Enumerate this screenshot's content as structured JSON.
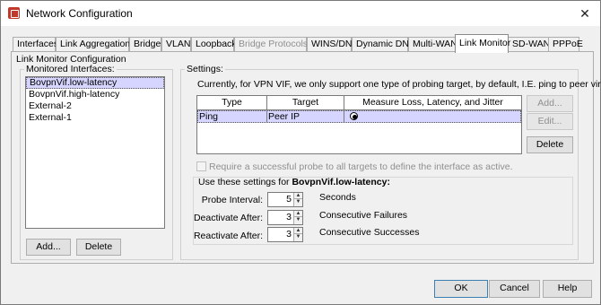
{
  "window": {
    "title": "Network Configuration",
    "close_glyph": "✕"
  },
  "tabs": [
    {
      "label": "Interfaces",
      "state": "normal"
    },
    {
      "label": "Link Aggregation",
      "state": "normal"
    },
    {
      "label": "Bridge",
      "state": "normal"
    },
    {
      "label": "VLAN",
      "state": "normal"
    },
    {
      "label": "Loopback",
      "state": "normal"
    },
    {
      "label": "Bridge Protocols",
      "state": "disabled"
    },
    {
      "label": "WINS/DNS",
      "state": "normal"
    },
    {
      "label": "Dynamic DNS",
      "state": "normal"
    },
    {
      "label": "Multi-WAN",
      "state": "normal"
    },
    {
      "label": "Link Monitor",
      "state": "active"
    },
    {
      "label": "SD-WAN",
      "state": "normal"
    },
    {
      "label": "PPPoE",
      "state": "normal"
    }
  ],
  "panel": {
    "heading": "Link Monitor Configuration",
    "monitored_title": "Monitored Interfaces:",
    "interfaces": [
      "BovpnVif.low-latency",
      "BovpnVif.high-latency",
      "External-2",
      "External-1"
    ],
    "add_label": "Add...",
    "delete_label": "Delete",
    "settings_title": "Settings:",
    "info": "Currently, for VPN VIF, we only support one type of probing target, by default, I.E. ping to peer virtual IP",
    "table": {
      "headers": [
        "Type",
        "Target",
        "Measure Loss, Latency, and Jitter"
      ],
      "rows": [
        {
          "type": "Ping",
          "target": "Peer IP",
          "measure": true
        }
      ]
    },
    "side_buttons": {
      "add": "Add...",
      "edit": "Edit...",
      "delete": "Delete"
    },
    "require_label": "Require a successful probe to all targets to define the interface as active.",
    "use_prefix": "Use these settings for ",
    "use_target": "BovpnVif.low-latency:",
    "probe_interval": {
      "label": "Probe Interval:",
      "value": "5",
      "unit": "Seconds"
    },
    "deactivate_after": {
      "label": "Deactivate After:",
      "value": "3",
      "unit": "Consecutive Failures"
    },
    "reactivate_after": {
      "label": "Reactivate After:",
      "value": "3",
      "unit": "Consecutive Successes"
    }
  },
  "footer": {
    "ok": "OK",
    "cancel": "Cancel",
    "help": "Help"
  }
}
